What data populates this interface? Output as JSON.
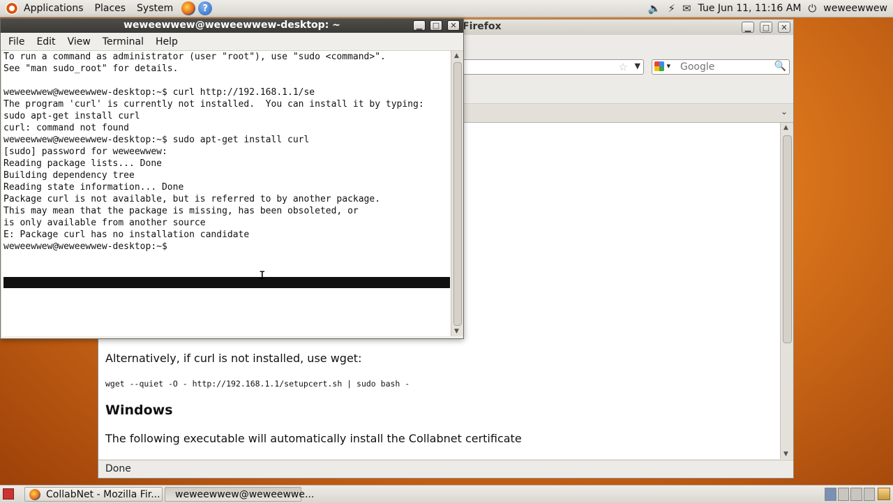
{
  "top_panel": {
    "menus": [
      "Applications",
      "Places",
      "System"
    ],
    "clock": "Tue Jun 11, 11:16 AM",
    "user": "weweewwew"
  },
  "firefox": {
    "title": "Firefox",
    "search_placeholder": "Google",
    "page": {
      "para_alt": "Alternatively, if curl is not installed, use wget:",
      "code_wget": "wget --quiet -O - http://192.168.1.1/setupcert.sh | sudo bash -",
      "heading_windows": "Windows",
      "para_windows": "The following executable will automatically install the Collabnet certificate"
    },
    "status": "Done"
  },
  "terminal": {
    "title": "weweewwew@weweewwew-desktop: ~",
    "menu": [
      "File",
      "Edit",
      "View",
      "Terminal",
      "Help"
    ],
    "output": "To run a command as administrator (user \"root\"), use \"sudo <command>\".\nSee \"man sudo_root\" for details.\n\nweweewwew@weweewwew-desktop:~$ curl http://192.168.1.1/se\nThe program 'curl' is currently not installed.  You can install it by typing:\nsudo apt-get install curl\ncurl: command not found\nweweewwew@weweewwew-desktop:~$ sudo apt-get install curl\n[sudo] password for weweewwew:\nReading package lists... Done\nBuilding dependency tree\nReading state information... Done\nPackage curl is not available, but is referred to by another package.\nThis may mean that the package is missing, has been obsoleted, or\nis only available from another source\nE: Package curl has no installation candidate\nweweewwew@weweewwew-desktop:~$"
  },
  "taskbar": {
    "firefox": "CollabNet - Mozilla Fir...",
    "terminal": "weweewwew@weweewwe..."
  }
}
